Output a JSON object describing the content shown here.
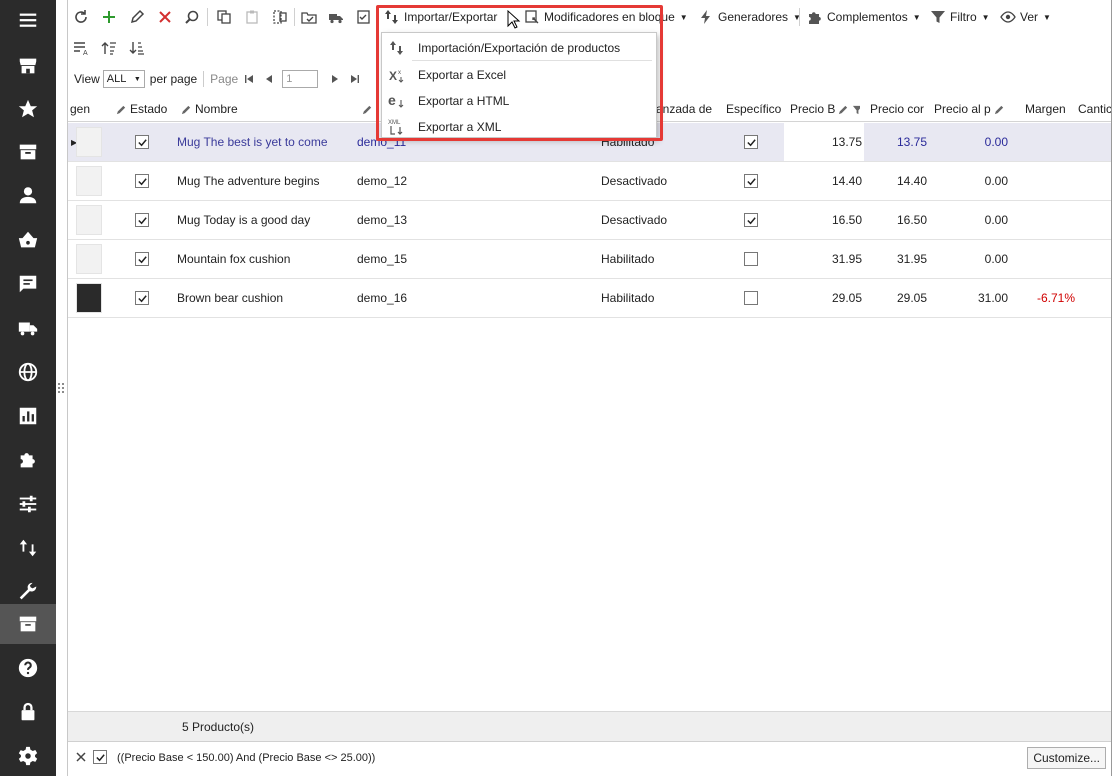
{
  "sidebar": {
    "icons": [
      "menu-icon",
      "store-icon",
      "star-icon",
      "archive-icon",
      "user-icon",
      "basket-icon",
      "chat-icon",
      "truck-icon",
      "globe-icon",
      "bar-chart-icon",
      "puzzle-icon",
      "sliders-icon",
      "import-export-icon",
      "wrench-icon",
      "archive-box-icon",
      "help-icon",
      "lock-icon",
      "settings-icon"
    ],
    "active_index": 14
  },
  "toolbar": {
    "import_export_label": "Importar/Exportar",
    "bulk_modifiers_label": "Modificadores en bloque",
    "generators_label": "Generadores",
    "addons_label": "Complementos",
    "filter_label": "Filtro",
    "view_label": "Ver"
  },
  "pager": {
    "view_label": "View",
    "per_page_value": "ALL",
    "per_page_label": "per page",
    "page_label": "Page",
    "page_value": "1"
  },
  "dropdown_menu": {
    "items": [
      {
        "label": "Importación/Exportación de productos",
        "icon": "import-export-icon"
      },
      {
        "label": "Exportar a Excel",
        "icon": "excel-icon"
      },
      {
        "label": "Exportar a HTML",
        "icon": "html-icon"
      },
      {
        "label": "Exportar a XML",
        "icon": "xml-icon"
      }
    ]
  },
  "grid": {
    "columns": [
      "gen",
      "Estado",
      "Nombre",
      "",
      "anzada de",
      "Específico",
      "Precio B",
      "Precio cor",
      "Precio al p",
      "Margen",
      "Cantic"
    ],
    "rows": [
      {
        "name": "Mug The best is yet to come",
        "ref": "demo_11",
        "status": "Habilitado",
        "specific": true,
        "base": "13.75",
        "cost": "13.75",
        "retail": "0.00",
        "margin": ""
      },
      {
        "name": "Mug The adventure begins",
        "ref": "demo_12",
        "status": "Desactivado",
        "specific": true,
        "base": "14.40",
        "cost": "14.40",
        "retail": "0.00",
        "margin": ""
      },
      {
        "name": "Mug Today is a good day",
        "ref": "demo_13",
        "status": "Desactivado",
        "specific": true,
        "base": "16.50",
        "cost": "16.50",
        "retail": "0.00",
        "margin": ""
      },
      {
        "name": "Mountain fox cushion",
        "ref": "demo_15",
        "status": "Habilitado",
        "specific": false,
        "base": "31.95",
        "cost": "31.95",
        "retail": "0.00",
        "margin": ""
      },
      {
        "name": "Brown bear cushion",
        "ref": "demo_16",
        "status": "Habilitado",
        "specific": false,
        "base": "29.05",
        "cost": "29.05",
        "retail": "31.00",
        "margin": "-6.71%"
      }
    ]
  },
  "footer": {
    "count_label": "5 Producto(s)",
    "filter_text": "((Precio Base < 150.00) And (Precio Base <> 25.00))",
    "customize_label": "Customize..."
  },
  "colors": {
    "sidebar_bg": "#2b2b2b",
    "highlight_red": "#e53935",
    "selected_row": "#e8e8f2",
    "link_blue": "#2a2a9a",
    "negative_red": "#d00000"
  }
}
